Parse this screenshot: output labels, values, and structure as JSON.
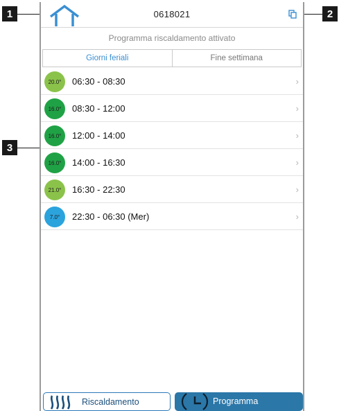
{
  "callouts": {
    "c1": "1",
    "c2": "2",
    "c3": "3"
  },
  "header": {
    "device_id": "0618021"
  },
  "status": {
    "text": "Programma riscaldamento attivato"
  },
  "tabs": [
    {
      "label": "Giorni feriali",
      "active": true
    },
    {
      "label": "Fine settimana",
      "active": false
    }
  ],
  "schedule": [
    {
      "temp": "20.0°",
      "time": "06:30 - 08:30",
      "color": "#8bc34a"
    },
    {
      "temp": "16.0°",
      "time": "08:30 - 12:00",
      "color": "#1fa245"
    },
    {
      "temp": "16.0°",
      "time": "12:00 - 14:00",
      "color": "#1fa245"
    },
    {
      "temp": "16.0°",
      "time": "14:00 - 16:30",
      "color": "#1fa245"
    },
    {
      "temp": "21.0°",
      "time": "16:30 - 22:30",
      "color": "#8bc34a"
    },
    {
      "temp": "7.0°",
      "time": "22:30 - 06:30 (Mer)",
      "color": "#2ba3dd"
    }
  ],
  "bottom": {
    "heating_label": "Riscaldamento",
    "program_label": "Programma"
  },
  "icons": {
    "home": "home-icon",
    "copy": "copy-icon",
    "chevron": "chevron-right-icon",
    "heating": "heating-icon",
    "clock": "clock-icon"
  },
  "colors": {
    "accent": "#3a8fd2",
    "program_button": "#2b77a8"
  }
}
